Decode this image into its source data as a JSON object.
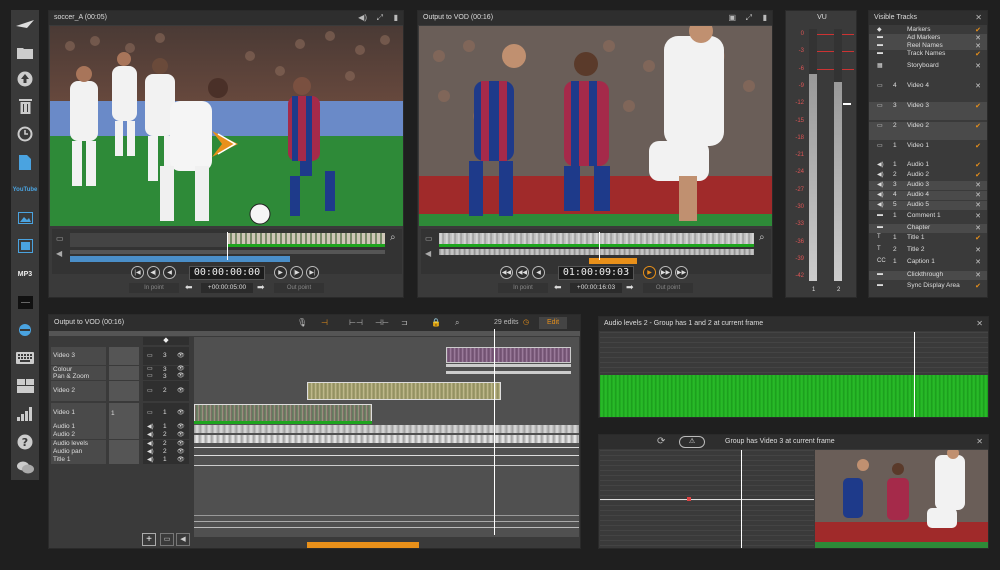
{
  "sidebar": {
    "icons": [
      "logo-icon",
      "folder-icon",
      "upload-icon",
      "trash-icon",
      "history-icon",
      "document-icon",
      "youtube-icon",
      "image-icon",
      "video-file-icon",
      "mp3-icon",
      "black-square-icon",
      "web-icon",
      "keyboard-icon",
      "layout-icon",
      "bars-chart-icon",
      "help-icon",
      "chat-icon"
    ],
    "youtube_label": "YouTube",
    "mp3_label": "MP3"
  },
  "source_viewer": {
    "title": "soccer_A (00:05)",
    "timecode": "00:00:00:00",
    "duration": "+00:00:05:00",
    "in_point": "In point",
    "out_point": "Out point"
  },
  "output_viewer": {
    "title": "Output to VOD (00:16)",
    "timecode": "01:00:09:03",
    "duration": "+00:00:16:03",
    "in_point": "In point",
    "out_point": "Out point"
  },
  "vu": {
    "title": "VU",
    "scale": [
      "0",
      "-3",
      "-6",
      "-9",
      "-12",
      "-15",
      "-18",
      "-21",
      "-24",
      "-27",
      "-30",
      "-33",
      "-36",
      "-39",
      "-42"
    ],
    "channels": [
      "1",
      "2"
    ],
    "levels": [
      0.82,
      0.79
    ]
  },
  "visible_tracks": {
    "title": "Visible Tracks",
    "items": [
      {
        "num": "",
        "label": "Markers",
        "state": "check"
      },
      {
        "num": "",
        "label": "Ad Markers",
        "state": "x"
      },
      {
        "num": "",
        "label": "Reel Names",
        "state": "x"
      },
      {
        "num": "",
        "label": "Track Names",
        "state": "check"
      },
      {
        "num": "",
        "label": "Storyboard",
        "state": "x"
      },
      {
        "num": "4",
        "label": "Video 4",
        "state": "x"
      },
      {
        "num": "3",
        "label": "Video 3",
        "state": "check"
      },
      {
        "num": "2",
        "label": "Video 2",
        "state": "check"
      },
      {
        "num": "1",
        "label": "Video 1",
        "state": "check"
      },
      {
        "num": "1",
        "label": "Audio 1",
        "state": "check"
      },
      {
        "num": "2",
        "label": "Audio 2",
        "state": "check"
      },
      {
        "num": "3",
        "label": "Audio 3",
        "state": "x"
      },
      {
        "num": "4",
        "label": "Audio 4",
        "state": "x"
      },
      {
        "num": "5",
        "label": "Audio 5",
        "state": "x"
      },
      {
        "num": "1",
        "label": "Comment 1",
        "state": "x"
      },
      {
        "num": "",
        "label": "Chapter",
        "state": "x"
      },
      {
        "num": "1",
        "label": "Title 1",
        "state": "check"
      },
      {
        "num": "2",
        "label": "Title 2",
        "state": "x"
      },
      {
        "num": "1",
        "label": "Caption 1",
        "state": "x"
      },
      {
        "num": "",
        "label": "Clickthrough",
        "state": "x"
      },
      {
        "num": "",
        "label": "Sync Display Area",
        "state": "check"
      }
    ]
  },
  "timeline": {
    "title": "Output to VOD (00:16)",
    "edits": "29 edits",
    "edit_label": "Edit",
    "tracks": [
      {
        "label": "Video 3",
        "num": "3"
      },
      {
        "label": "Colour",
        "num": "3"
      },
      {
        "label": "Pan & Zoom",
        "num": "3"
      },
      {
        "label": "Video 2",
        "num": "2"
      },
      {
        "label": "Video 1",
        "num": "1"
      },
      {
        "label": "Audio 1",
        "num": "1"
      },
      {
        "label": "Audio 2",
        "num": "2"
      },
      {
        "label": "Audio levels",
        "num": "2"
      },
      {
        "label": "Audio pan",
        "num": "2"
      },
      {
        "label": "Title 1",
        "num": "1"
      }
    ],
    "video1_num": "1"
  },
  "audio_levels": {
    "title": "Audio levels 2 - Group has 1 and 2 at current frame"
  },
  "group_panel": {
    "title": "Group has Video 3 at current frame"
  },
  "colors": {
    "accent": "#e8901a",
    "check": "#e8901a",
    "green": "#1ea51e",
    "blue_bar": "#4a8ec8"
  }
}
